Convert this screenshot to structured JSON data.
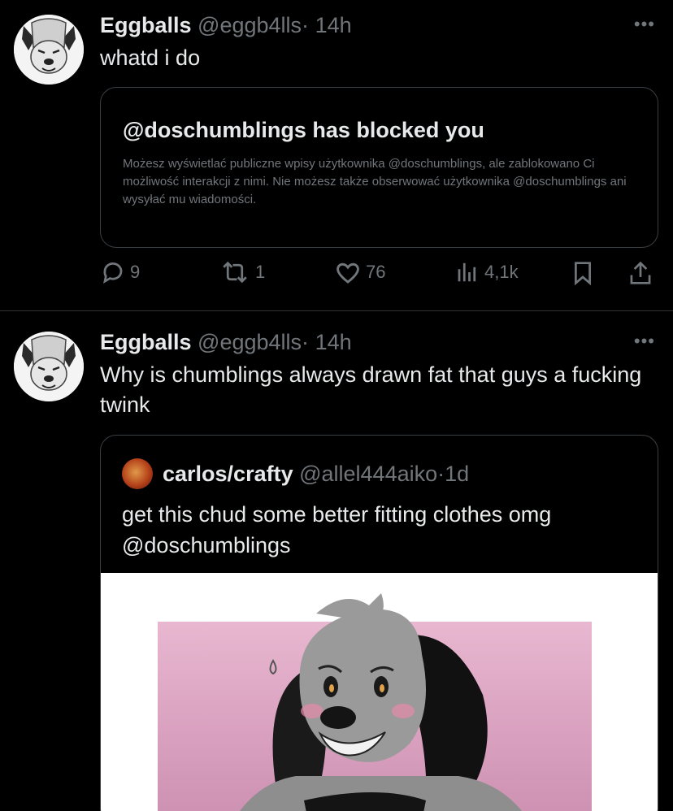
{
  "tweets": [
    {
      "name": "Eggballs",
      "handle": "@eggb4lls",
      "separator": "·",
      "time": "14h",
      "text": "whatd i do",
      "blocked_card": {
        "title": "@doschumblings has blocked you",
        "description": "Możesz wyświetlać publiczne wpisy użytkownika @doschumblings, ale zablokowano Ci możliwość interakcji z nimi. Nie możesz także obserwować użytkownika @doschumblings ani wysyłać mu wiadomości."
      },
      "actions": {
        "replies": "9",
        "reposts": "1",
        "likes": "76",
        "views": "4,1k"
      }
    },
    {
      "name": "Eggballs",
      "handle": "@eggb4lls",
      "separator": "·",
      "time": "14h",
      "text": "Why is chumblings always drawn fat that guys a fucking twink",
      "quote": {
        "name": "carlos/crafty",
        "handle": "@allel444aiko",
        "separator": "·",
        "time": "1d",
        "text_line1": "get this chud some better fitting clothes omg",
        "text_line2": "@doschumblings"
      }
    }
  ],
  "more_label": "•••",
  "icons": [
    "reply-icon",
    "repost-icon",
    "like-icon",
    "views-icon",
    "bookmark-icon",
    "share-icon",
    "more-icon"
  ],
  "colors": {
    "background": "#000000",
    "text": "#e7e9ea",
    "muted": "#71767b",
    "border": "#2f3336",
    "image_pink": "#dca6c4"
  }
}
